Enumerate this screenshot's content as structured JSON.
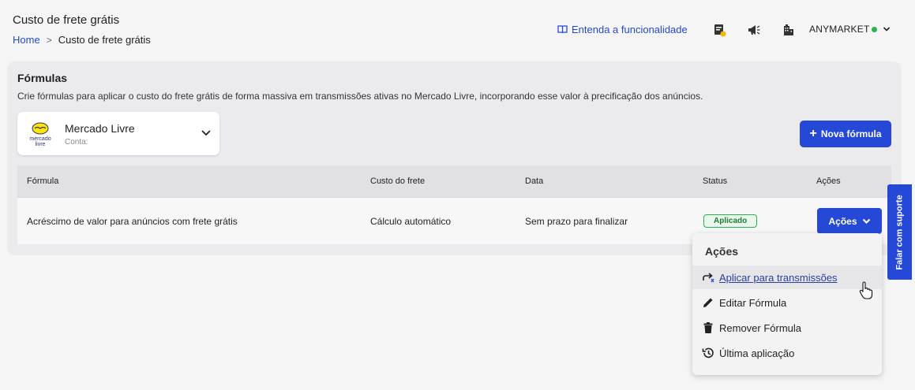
{
  "header": {
    "title": "Custo de frete grátis",
    "breadcrumb_home": "Home",
    "breadcrumb_sep": ">",
    "breadcrumb_current": "Custo de frete grátis",
    "help_link": "Entenda a funcionalidade",
    "account_name": "ANYMARKET"
  },
  "panel": {
    "title": "Fórmulas",
    "description": "Crie fórmulas para aplicar o custo do frete grátis de forma massiva em transmissões ativas no Mercado Livre, incorporando esse valor à precificação dos anúncios.",
    "marketplace": {
      "name": "Mercado Livre",
      "account_label": "Conta:",
      "logo_text_1": "mercado",
      "logo_text_2": "livre"
    },
    "new_button": "Nova fórmula"
  },
  "table": {
    "headers": [
      "Fórmula",
      "Custo do frete",
      "Data",
      "Status",
      "Ações"
    ],
    "rows": [
      {
        "formula": "Acréscimo de valor para anúncios com frete grátis",
        "shipping_cost": "Cálculo automático",
        "date": "Sem prazo para finalizar",
        "status": "Aplicado",
        "actions": "Ações"
      }
    ]
  },
  "dropdown": {
    "title": "Ações",
    "items": [
      {
        "label": "Aplicar para transmissões",
        "icon": "share-arrow-icon"
      },
      {
        "label": "Editar Fórmula",
        "icon": "pencil-icon"
      },
      {
        "label": "Remover Fórmula",
        "icon": "trash-icon"
      },
      {
        "label": "Última aplicação",
        "icon": "history-icon"
      }
    ]
  },
  "support_tab": "Falar com suporte",
  "colors": {
    "primary": "#2549d6",
    "success": "#2ab34a",
    "background": "#f5f5f6",
    "panel": "#ebebed"
  }
}
